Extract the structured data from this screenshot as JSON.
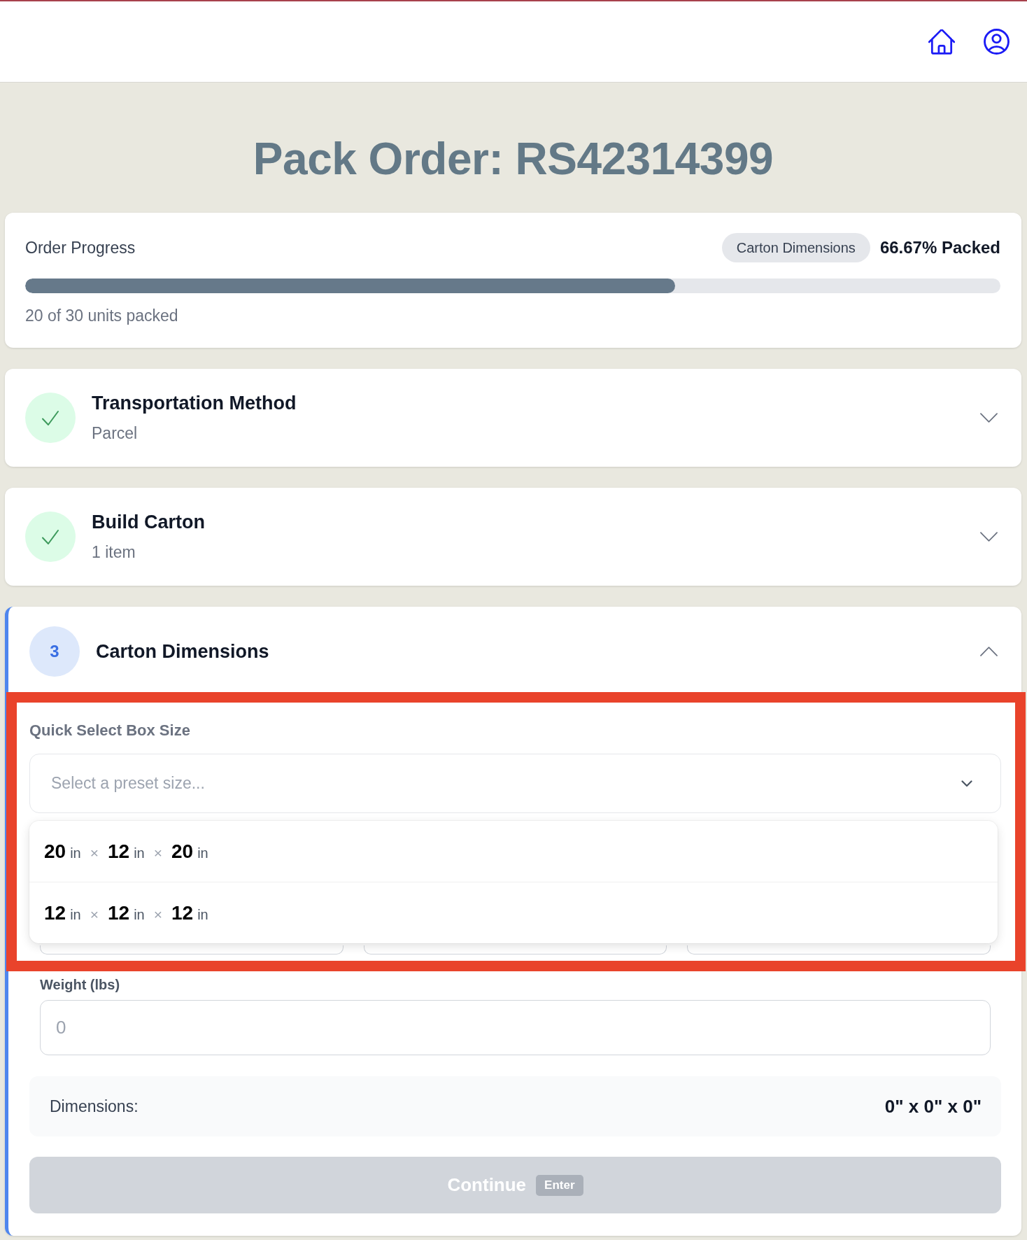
{
  "page_title": "Pack Order: RS42314399",
  "progress": {
    "title": "Order Progress",
    "badge": "Carton Dimensions",
    "percent_label": "66.67% Packed",
    "level": 0.6667,
    "caption": "20 of 30 units packed"
  },
  "steps": [
    {
      "kind": "completed",
      "title": "Transportation Method",
      "subtitle": "Parcel",
      "expanded": false
    },
    {
      "kind": "completed",
      "title": "Build Carton",
      "subtitle": "1 item",
      "expanded": false
    },
    {
      "kind": "current",
      "number": "3",
      "title": "Carton Dimensions",
      "expanded": true,
      "quick_select": {
        "label": "Quick Select Box Size",
        "placeholder": "Select a preset size...",
        "open": true,
        "highlighted": true,
        "options": [
          {
            "dims": [
              {
                "value": "20",
                "unit": "in"
              },
              {
                "value": "12",
                "unit": "in"
              },
              {
                "value": "20",
                "unit": "in"
              }
            ],
            "separators": [
              "×",
              "×"
            ],
            "selected": false
          },
          {
            "dims": [
              {
                "value": "12",
                "unit": "in"
              },
              {
                "value": "12",
                "unit": "in"
              },
              {
                "value": "12",
                "unit": "in"
              }
            ],
            "separators": [
              "×",
              "×"
            ],
            "selected": false
          }
        ]
      },
      "weight": {
        "label": "Weight (lbs)",
        "placeholder": "0"
      },
      "summary": {
        "label": "Dimensions:",
        "value": "0\" x 0\" x 0\""
      },
      "button": {
        "label": "Continue",
        "shortcut": "Enter",
        "disabled": true
      }
    }
  ]
}
